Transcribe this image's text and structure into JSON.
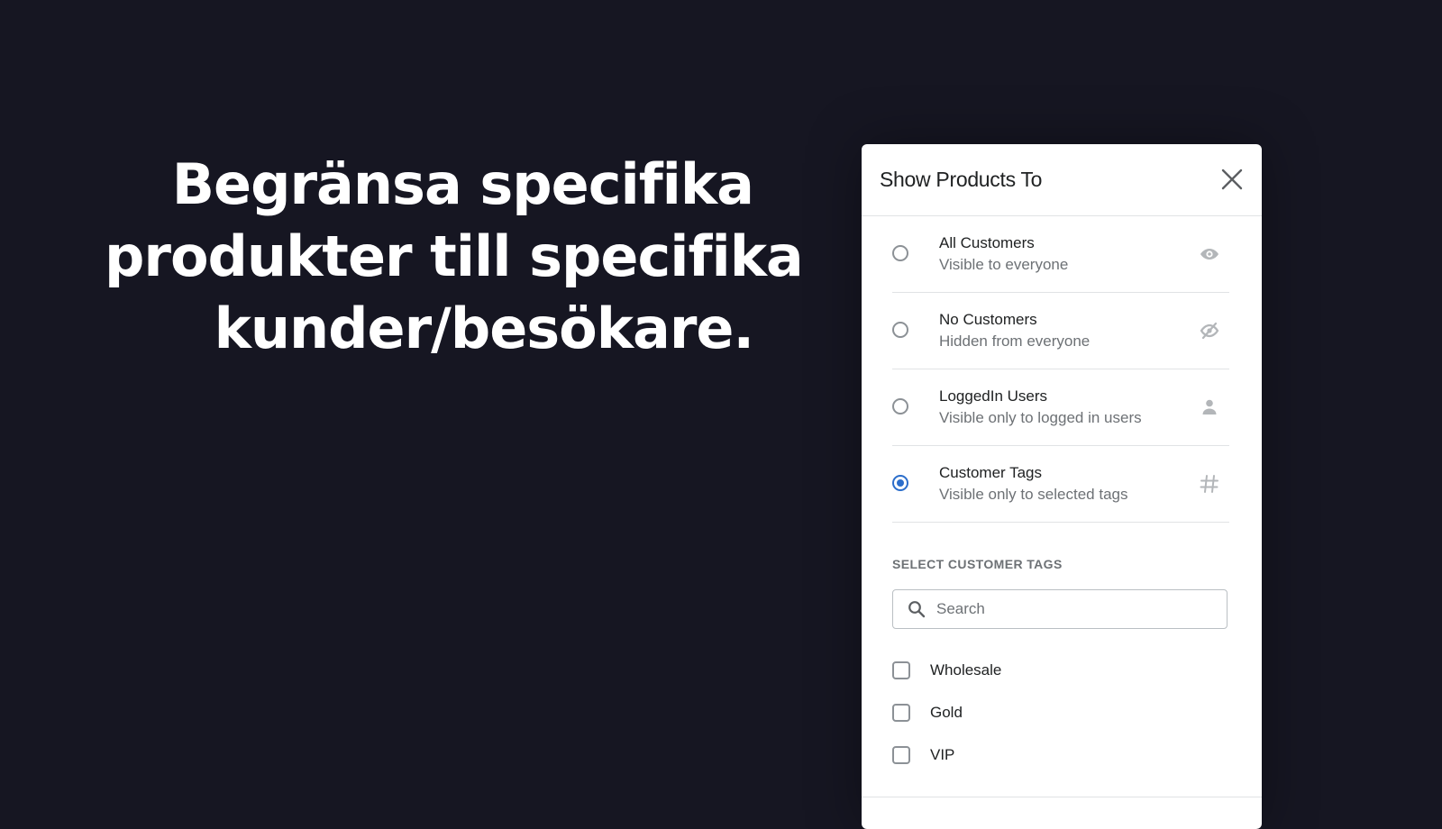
{
  "headline": {
    "lines": [
      "Begränsa specifika",
      "produkter till specifika",
      "kunder/besökare."
    ]
  },
  "modal": {
    "title": "Show Products To",
    "close_icon": "close-icon",
    "options": [
      {
        "label": "All Customers",
        "sublabel": "Visible to everyone",
        "icon": "eye-icon",
        "selected": false
      },
      {
        "label": "No Customers",
        "sublabel": "Hidden from everyone",
        "icon": "eye-off-icon",
        "selected": false
      },
      {
        "label": "LoggedIn Users",
        "sublabel": "Visible only to logged in users",
        "icon": "user-icon",
        "selected": false
      },
      {
        "label": "Customer Tags",
        "sublabel": "Visible only to selected tags",
        "icon": "hashtag-icon",
        "selected": true
      }
    ],
    "tags_section": {
      "label": "SELECT CUSTOMER TAGS",
      "search_placeholder": "Search",
      "search_value": "",
      "tags": [
        {
          "label": "Wholesale",
          "checked": false
        },
        {
          "label": "Gold",
          "checked": false
        },
        {
          "label": "VIP",
          "checked": false
        }
      ]
    }
  },
  "colors": {
    "background": "#161622",
    "accent": "#2c6ecb",
    "icon": "#8c9196"
  }
}
